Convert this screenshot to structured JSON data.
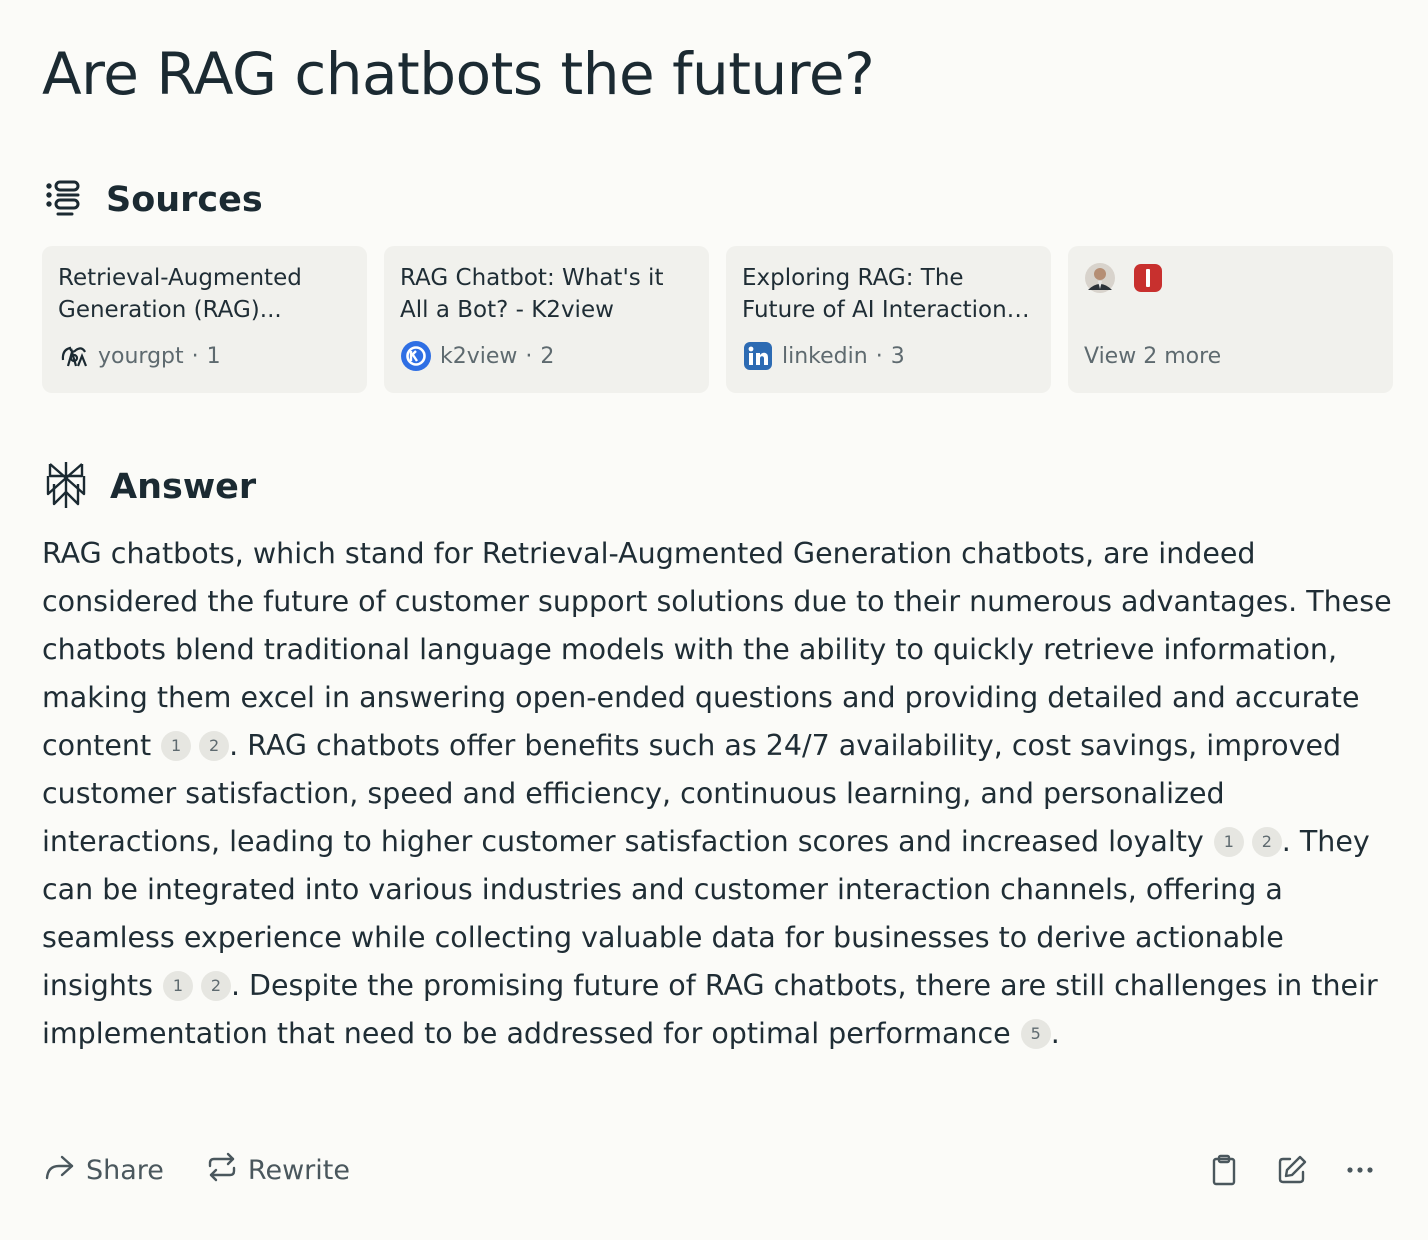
{
  "question": "Are RAG chatbots the future?",
  "sources": {
    "heading": "Sources",
    "cards": [
      {
        "title": "Retrieval-Augmented Generation (RAG)...",
        "site": "yourgpt",
        "num": "1"
      },
      {
        "title": "RAG Chatbot: What's it All a Bot? - K2view",
        "site": "k2view",
        "num": "2"
      },
      {
        "title": "Exploring RAG: The Future of AI Interaction. ...",
        "site": "linkedin",
        "num": "3"
      }
    ],
    "view_more": "View 2 more"
  },
  "answer": {
    "heading": "Answer",
    "seg1": "RAG chatbots, which stand for Retrieval-Augmented Generation chatbots, are indeed considered the future of customer support solutions due to their numerous advantages. These chatbots blend traditional language models with the ability to quickly retrieve information, making them excel in answering open-ended questions and providing detailed and accurate content",
    "seg2": ". RAG chatbots offer benefits such as 24/7 availability, cost savings, improved customer satisfaction, speed and efficiency, continuous learning, and personalized interactions, leading to higher customer satisfaction scores and increased loyalty",
    "seg3": ". They can be integrated into various industries and customer interaction channels, offering a seamless experience while collecting valuable data for businesses to derive actionable insights",
    "seg4": ". Despite the promising future of RAG chatbots, there are still challenges in their implementation that need to be addressed for optimal performance",
    "seg5": ".",
    "citations": {
      "c1": "1",
      "c2": "2",
      "c5": "5"
    }
  },
  "actions": {
    "share": "Share",
    "rewrite": "Rewrite"
  },
  "icons": [
    "sources-list-icon",
    "answer-logo-icon",
    "share-icon",
    "rewrite-icon",
    "clipboard-icon",
    "edit-icon",
    "more-icon"
  ]
}
